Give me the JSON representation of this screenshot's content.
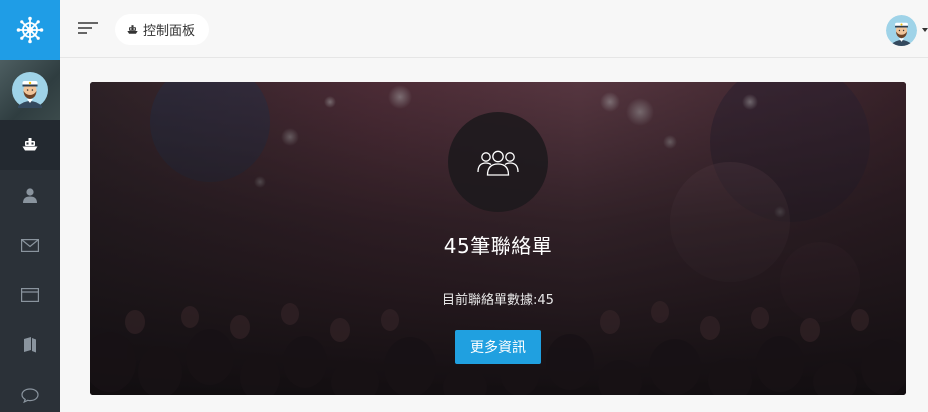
{
  "sidebar": {
    "logo_icon": "ship-wheel-icon",
    "user_avatar_icon": "captain-avatar-icon",
    "items": [
      {
        "icon": "ship-icon",
        "active": true
      },
      {
        "icon": "user-icon",
        "active": false
      },
      {
        "icon": "envelope-icon",
        "active": false
      },
      {
        "icon": "browser-window-icon",
        "active": false
      },
      {
        "icon": "book-icon",
        "active": false
      },
      {
        "icon": "chat-bubble-icon",
        "active": false
      }
    ]
  },
  "topbar": {
    "menu_icon": "menu-lines-icon",
    "breadcrumb": {
      "icon": "ship-icon",
      "label": "控制面板"
    },
    "avatar_icon": "captain-avatar-icon"
  },
  "hero": {
    "icon": "users-group-icon",
    "title": "45筆聯絡單",
    "subtitle": "目前聯絡單數據:45",
    "button_label": "更多資訊"
  },
  "colors": {
    "sidebar_bg": "#2b3138",
    "logo_bg": "#1f9de6",
    "button_bg": "#20a0e0",
    "topbar_bg": "#f7f7f7"
  }
}
